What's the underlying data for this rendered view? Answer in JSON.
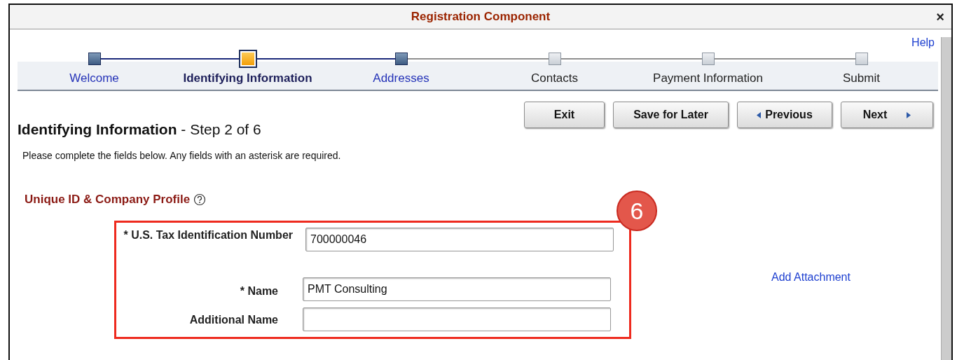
{
  "window": {
    "title": "Registration Component",
    "close": "×"
  },
  "help": "Help",
  "steps": [
    {
      "label": "Welcome",
      "selected": false,
      "completed": true
    },
    {
      "label": "Identifying Information",
      "selected": true,
      "completed": false
    },
    {
      "label": "Addresses",
      "selected": false,
      "completed": true
    },
    {
      "label": "Contacts",
      "selected": false,
      "completed": false
    },
    {
      "label": "Payment Information",
      "selected": false,
      "completed": false
    },
    {
      "label": "Submit",
      "selected": false,
      "completed": false
    }
  ],
  "buttons": [
    {
      "label": "Exit",
      "kind": "plain"
    },
    {
      "label": "Save for Later",
      "kind": "plain"
    },
    {
      "label": "Previous",
      "kind": "back"
    },
    {
      "label": "Next",
      "kind": "forward"
    }
  ],
  "page_title": {
    "title": "Identifying Information",
    "step": " - Step 2 of 6"
  },
  "instructions": "Please complete the fields below.  Any fields with an asterisk are required.",
  "section": {
    "title": "Unique ID & Company Profile"
  },
  "callout": {
    "number": "6"
  },
  "fields": [
    {
      "label": "* U.S. Tax Identification Number",
      "value": "700000046"
    },
    {
      "label": "* Name",
      "value": "PMT Consulting"
    },
    {
      "label": "Additional Name"
    }
  ],
  "add_attachment": "Add Attachment"
}
